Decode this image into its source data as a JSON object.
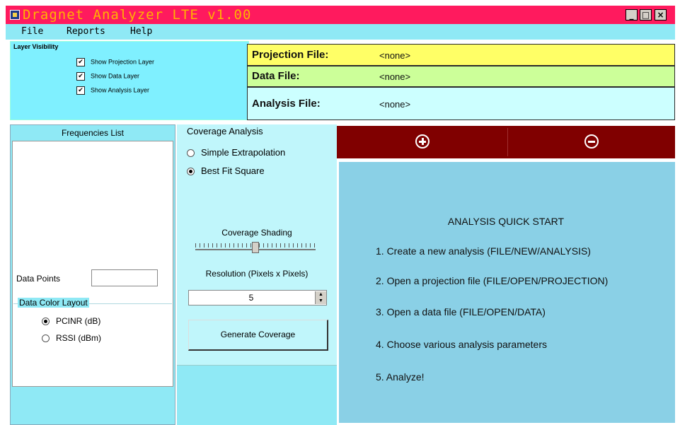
{
  "window": {
    "title": "Dragnet Analyzer LTE v1.00",
    "min_glyph": "_",
    "max_glyph": "□",
    "close_glyph": "×"
  },
  "menu": [
    "File",
    "Reports",
    "Help"
  ],
  "layer_visibility": {
    "title": "Layer Visibility",
    "items": [
      {
        "label": "Show Projection Layer",
        "checked": true
      },
      {
        "label": "Show Data Layer",
        "checked": true
      },
      {
        "label": "Show Analysis Layer",
        "checked": true
      }
    ],
    "check_glyph": "✔"
  },
  "files": {
    "projection": {
      "label": "Projection File:",
      "value": "<none>"
    },
    "data": {
      "label": "Data File:",
      "value": "<none>"
    },
    "analysis": {
      "label": "Analysis File:",
      "value": "<none>"
    }
  },
  "frequencies": {
    "title": "Frequencies List",
    "data_points_label": "Data Points",
    "data_points_value": "",
    "color_layout": {
      "label": "Data Color Layout",
      "options": [
        {
          "label": "PCINR (dB)",
          "selected": true
        },
        {
          "label": "RSSI (dBm)",
          "selected": false
        }
      ]
    }
  },
  "coverage": {
    "title": "Coverage Analysis",
    "methods": [
      {
        "label": "Simple Extrapolation",
        "selected": false
      },
      {
        "label": "Best Fit Square",
        "selected": true
      }
    ],
    "shading_label": "Coverage Shading",
    "shading_level": 0.5,
    "resolution_label": "Resolution (Pixels x Pixels)",
    "resolution_value": "5",
    "spin_up": "▲",
    "spin_down": "▼",
    "generate_label": "Generate Coverage"
  },
  "zoom": {
    "in_icon": "zoom-in-icon",
    "out_icon": "zoom-out-icon"
  },
  "quick_start": {
    "title": "ANALYSIS QUICK START",
    "steps": [
      "1. Create a new analysis (FILE/NEW/ANALYSIS)",
      "2. Open a projection file (FILE/OPEN/PROJECTION)",
      "3. Open a data file (FILE/OPEN/DATA)",
      "4. Choose various analysis parameters",
      "5. Analyze!"
    ]
  }
}
